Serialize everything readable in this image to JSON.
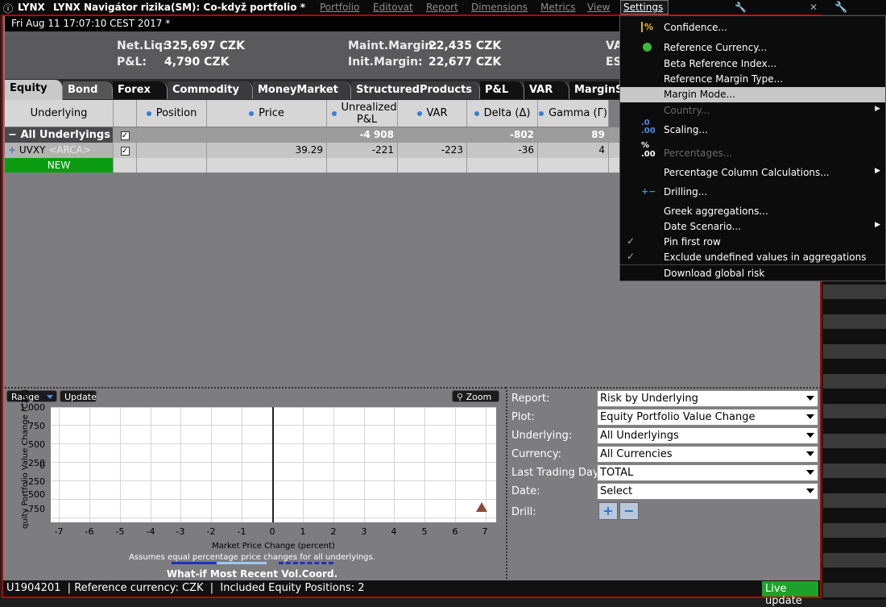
{
  "window": {
    "app": "LYNX",
    "title": "LYNX Navigátor rizika(SM): Co-když portfolio *",
    "menus": [
      "Portfolio",
      "Editovat",
      "Report",
      "Dimensions",
      "Metrics",
      "View"
    ],
    "settings_label": "Settings"
  },
  "datebar": {
    "text": "Fri Aug 11 17:07:10 CEST 2017 *"
  },
  "summary": {
    "net_liq_label": "Net.Liq:",
    "net_liq_value": "325,697 CZK",
    "pnl_label": "P&L:",
    "pnl_value": "4,790 CZK",
    "maint_label": "Maint.Margin:",
    "maint_value": "22,435 CZK",
    "init_label": "Init.Margin:",
    "init_value": "22,677 CZK",
    "extra1": "VA",
    "extra2": "ES"
  },
  "tabs": [
    "Equity",
    "Bond",
    "Forex",
    "Commodity",
    "MoneyMarket",
    "StructuredProducts",
    "P&L",
    "VAR",
    "MarginS"
  ],
  "grid": {
    "headers": {
      "underlying": "Underlying",
      "position": "Position",
      "price": "Price",
      "unrealized": "Unrealized P&L",
      "var": "VAR",
      "delta": "Delta (Δ)",
      "gamma": "Gamma (Γ)"
    },
    "all_row": {
      "label": "All Underlyings",
      "unrealized": "-4 908",
      "delta": "-802",
      "gamma": "89"
    },
    "uvxy_row": {
      "label": "UVXY",
      "exchange": "<ARCA>",
      "price": "39.29",
      "unrealized": "-221",
      "var": "-223",
      "delta": "-36",
      "gamma": "4"
    },
    "new_row": {
      "label": "NEW"
    }
  },
  "dropdown": {
    "items": [
      {
        "label": "Confidence...",
        "icon": "percent-icon"
      },
      {
        "label": "Reference Currency...",
        "icon": "dollar-icon"
      },
      {
        "label": "Beta Reference Index..."
      },
      {
        "label": "Reference Margin Type..."
      },
      {
        "label": "Margin Mode..."
      },
      {
        "label": "Country..."
      },
      {
        "label": "Scaling...",
        "icon": "scaling-icon"
      },
      {
        "label": "Percentages...",
        "icon": "percentages-icon"
      },
      {
        "label": "Percentage Column Calculations..."
      },
      {
        "label": "Drilling...",
        "icon": "drilling-icon"
      },
      {
        "label": "Greek aggregations..."
      },
      {
        "label": "Date Scenario..."
      },
      {
        "label": "Pin first row"
      },
      {
        "label": "Exclude undefined values in aggregations"
      },
      {
        "label": "Download global risk"
      }
    ],
    "icon_text": {
      "percent": "%",
      "scaling": ".0",
      "scaling2": ".00",
      "percentages": "%",
      "percentages2": ".00",
      "check": "✓",
      "arrow": "▶"
    }
  },
  "chart": {
    "range_label": "Range",
    "update_label": "Update",
    "zoom_label": "Zoom",
    "ylabel": "quity Portfolio Value Change (CZK)",
    "xlabel": "Market Price Change (percent)",
    "note": "Assumes equal percentage price changes for all underlyings.",
    "footer": "What-if Most Recent Vol.Coord.",
    "yticks": [
      "1 000",
      "750",
      "500",
      "250",
      "0",
      "-250",
      "-500",
      "-750"
    ],
    "xticks": [
      "-7",
      "-6",
      "-5",
      "-4",
      "-3",
      "-2",
      "-1",
      "0",
      "1",
      "2",
      "3",
      "4",
      "5",
      "6",
      "7"
    ]
  },
  "controls": {
    "report_label": "Report:",
    "report_value": "Risk by Underlying",
    "plot_label": "Plot:",
    "plot_value": "Equity Portfolio Value Change",
    "underlying_label": "Underlying:",
    "underlying_value": "All Underlyings",
    "currency_label": "Currency:",
    "currency_value": "All Currencies",
    "ltd_label": "Last Trading Day:",
    "ltd_value": "TOTAL",
    "date_label": "Date:",
    "date_value": "Select",
    "drill_label": "Drill:"
  },
  "status": {
    "text": "U1904201  | Reference currency: CZK  |  Included Equity Positions: 2",
    "live": "Live update"
  },
  "colors": {
    "accent_red": "#c00000",
    "new_green": "#0c9c12",
    "live_green": "#1ea12a"
  }
}
